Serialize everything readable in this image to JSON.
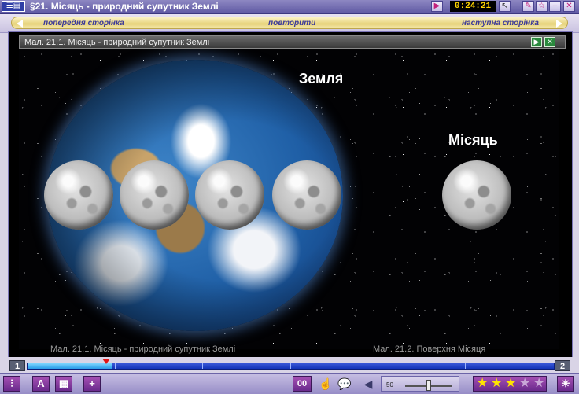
{
  "window": {
    "title": "§21. Місяць - природний супутник Землі",
    "timer": "0:24:21"
  },
  "nav": {
    "prev_label": "попередня сторінка",
    "repeat_label": "повторити",
    "next_label": "наступна сторінка"
  },
  "figure": {
    "caption": "Мал. 21.1. Місяць - природний супутник Землі",
    "earth_label": "Земля",
    "moon_label": "Місяць",
    "ghost_caption_left": "Мал. 21.1. Місяць - природний супутник Землі",
    "ghost_caption_right": "Мал. 21.2. Поверхня Місяця"
  },
  "pager": {
    "current_page": "1",
    "next_page": "2",
    "progress_fraction": 0.16,
    "playhead_fraction": 0.15
  },
  "toolbar": {
    "double_zero_label": "00",
    "add_label": "+",
    "volume_value": "50",
    "volume_fraction": 0.5,
    "rating_stars": 3,
    "rating_max": 5
  },
  "colors": {
    "accent_purple": "#6a2a8c",
    "track_blue": "#1434b8",
    "star_yellow": "#ffe400"
  }
}
